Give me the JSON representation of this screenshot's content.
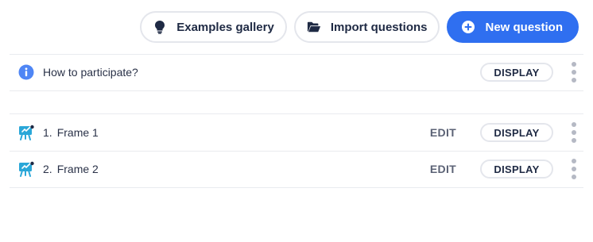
{
  "toolbar": {
    "examples_label": "Examples gallery",
    "import_label": "Import questions",
    "new_label": "New question"
  },
  "info_row": {
    "label": "How to participate?",
    "display_label": "DISPLAY"
  },
  "frames": [
    {
      "number": "1.",
      "title": "Frame 1",
      "edit_label": "EDIT",
      "display_label": "DISPLAY"
    },
    {
      "number": "2.",
      "title": "Frame 2",
      "edit_label": "EDIT",
      "display_label": "DISPLAY"
    }
  ],
  "colors": {
    "primary": "#2f6ff0",
    "info": "#4f86f5",
    "frame_icon": "#2aa7d8"
  },
  "icons": [
    "lightbulb-icon",
    "folder-open-icon",
    "plus-circle-icon",
    "info-icon",
    "frame-presentation-icon",
    "more-vertical-icon"
  ]
}
